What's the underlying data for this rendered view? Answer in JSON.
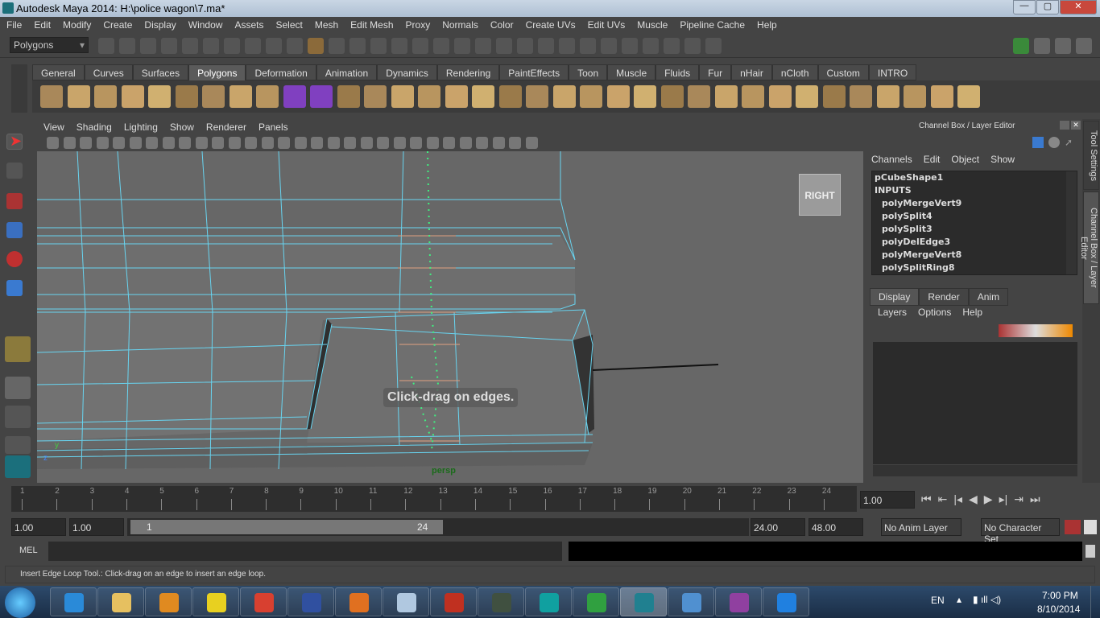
{
  "window": {
    "title": "Autodesk Maya 2014: H:\\police wagon\\7.ma*",
    "minimize": "—",
    "maximize": "▢",
    "close": "✕"
  },
  "menubar": [
    "File",
    "Edit",
    "Modify",
    "Create",
    "Display",
    "Window",
    "Assets",
    "Select",
    "Mesh",
    "Edit Mesh",
    "Proxy",
    "Normals",
    "Color",
    "Create UVs",
    "Edit UVs",
    "Muscle",
    "Pipeline Cache",
    "Help"
  ],
  "statusline": {
    "menuset": "Polygons"
  },
  "shelf": {
    "tabs": [
      "General",
      "Curves",
      "Surfaces",
      "Polygons",
      "Deformation",
      "Animation",
      "Dynamics",
      "Rendering",
      "PaintEffects",
      "Toon",
      "Muscle",
      "Fluids",
      "Fur",
      "nHair",
      "nCloth",
      "Custom",
      "INTRO"
    ],
    "active": "Polygons",
    "icons": [
      "sphere",
      "cube",
      "cylinder",
      "cone",
      "plane",
      "torus",
      "pyramid",
      "pipe",
      "soccer-ball",
      "combine",
      "separate",
      "extract",
      "smooth",
      "bool",
      "mirror",
      "average",
      "fill-hole",
      "make-hole",
      "bridge",
      "append",
      "split",
      "wedge",
      "extrude",
      "poke",
      "bevel",
      "duplicate-face",
      "subdiv",
      "sculpt",
      "uv-planar",
      "uv-cylindrical",
      "uv-spherical",
      "uv-auto",
      "uv-editor",
      "uv-layout",
      "uv-smudge"
    ]
  },
  "viewport": {
    "menu": [
      "View",
      "Shading",
      "Lighting",
      "Show",
      "Renderer",
      "Panels"
    ],
    "camera": "persp",
    "viewcube": "RIGHT",
    "hud_message": "Click-drag on edges.",
    "axis": {
      "y": "y",
      "z": "z"
    }
  },
  "channel_box": {
    "title": "Channel Box / Layer Editor",
    "menu": [
      "Channels",
      "Edit",
      "Object",
      "Show"
    ],
    "items": [
      {
        "label": "pCubeShape1",
        "indent": false
      },
      {
        "label": "INPUTS",
        "indent": false
      },
      {
        "label": "polyMergeVert9",
        "indent": true
      },
      {
        "label": "polySplit4",
        "indent": true
      },
      {
        "label": "polySplit3",
        "indent": true
      },
      {
        "label": "polyDelEdge3",
        "indent": true
      },
      {
        "label": "polyMergeVert8",
        "indent": true
      },
      {
        "label": "polySplitRing8",
        "indent": true
      }
    ]
  },
  "layer_editor": {
    "tabs": [
      "Display",
      "Render",
      "Anim"
    ],
    "active": "Display",
    "menu": [
      "Layers",
      "Options",
      "Help"
    ]
  },
  "side_tabs": [
    "Tool Settings",
    "Channel Box / Layer Editor"
  ],
  "timeline": {
    "ticks": [
      "1",
      "2",
      "3",
      "4",
      "5",
      "6",
      "7",
      "8",
      "9",
      "10",
      "11",
      "12",
      "13",
      "14",
      "15",
      "16",
      "17",
      "18",
      "19",
      "20",
      "21",
      "22",
      "23",
      "24"
    ],
    "current_frame": "1.00"
  },
  "range": {
    "start": "1.00",
    "playback_start": "1.00",
    "slider_start": "1",
    "slider_end": "24",
    "playback_end": "24.00",
    "end": "48.00",
    "anim_layer": "No Anim Layer",
    "character_set": "No Character Set"
  },
  "command_line": {
    "label": "MEL",
    "value": ""
  },
  "help_line": "Insert Edge Loop Tool.: Click-drag on an edge to insert an edge loop.",
  "taskbar": {
    "apps": [
      {
        "name": "internet-explorer",
        "color": "#2a8ad8"
      },
      {
        "name": "file-explorer",
        "color": "#e6c060"
      },
      {
        "name": "media-player",
        "color": "#e08a20"
      },
      {
        "name": "pattis",
        "color": "#e8d020"
      },
      {
        "name": "chrome",
        "color": "#d84030"
      },
      {
        "name": "kmplayer",
        "color": "#3050a0"
      },
      {
        "name": "firefox",
        "color": "#e07020"
      },
      {
        "name": "paint",
        "color": "#b0c8e0"
      },
      {
        "name": "task-manager",
        "color": "#c03020"
      },
      {
        "name": "cmd-monitor",
        "color": "#405040"
      },
      {
        "name": "eset",
        "color": "#10a0a0"
      },
      {
        "name": "download-manager",
        "color": "#30a040"
      },
      {
        "name": "maya",
        "color": "#208090"
      },
      {
        "name": "control-panel",
        "color": "#5090d0"
      },
      {
        "name": "yahoo-messenger",
        "color": "#9040a0"
      },
      {
        "name": "quicktime",
        "color": "#2080e0"
      }
    ],
    "language": "EN",
    "time": "7:00 PM",
    "date": "8/10/2014"
  }
}
